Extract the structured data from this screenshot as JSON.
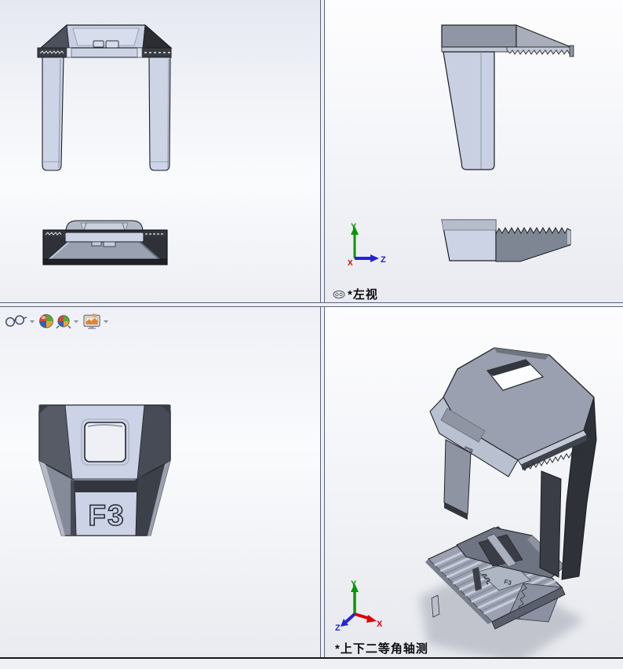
{
  "viewports": {
    "top_right": {
      "label": "*左视"
    },
    "bottom_right": {
      "label": "*上下二等角轴测"
    }
  },
  "triad": {
    "x_label": "X",
    "y_label": "Y",
    "z_label": "Z",
    "x_color": "#dd0000",
    "y_color": "#009900",
    "z_color": "#2222dd"
  },
  "heads_up_toolbar": {
    "items": [
      {
        "name": "hide-show-items",
        "icon": "glasses-icon",
        "has_dropdown": true
      },
      {
        "name": "edit-appearance",
        "icon": "color-sphere-icon",
        "has_dropdown": false
      },
      {
        "name": "apply-scene",
        "icon": "scene-ball-icon",
        "has_dropdown": true
      },
      {
        "name": "view-settings",
        "icon": "monitor-icon",
        "has_dropdown": true
      }
    ]
  },
  "model": {
    "engraving": "F3",
    "body_color": "#ccd3e6",
    "mid_gray_color": "#9aa0af",
    "dark_color": "#2e3138"
  }
}
